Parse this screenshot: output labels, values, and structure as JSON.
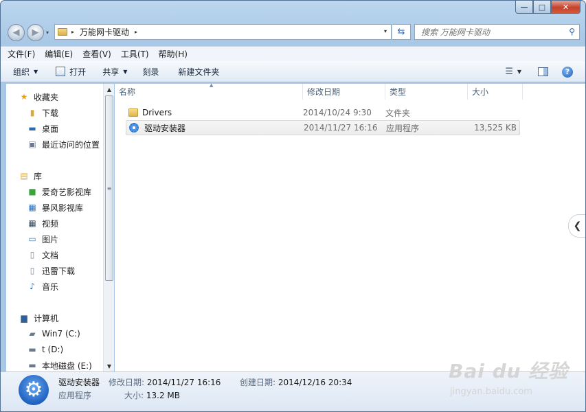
{
  "window": {
    "minimize": "—",
    "maximize": "□",
    "close": "✕"
  },
  "nav": {
    "back": "◀",
    "forward": "▶",
    "dropdown": "▾"
  },
  "address": {
    "crumbs": [
      "万能网卡驱动"
    ],
    "sep": "▸",
    "drop": "▾",
    "refresh": "⇆"
  },
  "search": {
    "placeholder": "搜索 万能网卡驱动",
    "icon": "search-icon"
  },
  "menu": [
    "文件(F)",
    "编辑(E)",
    "查看(V)",
    "工具(T)",
    "帮助(H)"
  ],
  "toolbar": {
    "organize": "组织",
    "open": "打开",
    "share": "共享",
    "burn": "刻录",
    "new_folder": "新建文件夹",
    "help": "?"
  },
  "sidebar": {
    "favorites": {
      "label": "收藏夹",
      "items": [
        "下载",
        "桌面",
        "最近访问的位置"
      ]
    },
    "libraries": {
      "label": "库",
      "items": [
        "爱奇艺影视库",
        "暴风影视库",
        "视频",
        "图片",
        "文档",
        "迅雷下载",
        "音乐"
      ]
    },
    "computer": {
      "label": "计算机",
      "items": [
        "Win7 (C:)",
        "t (D:)",
        "本地磁盘 (E:)"
      ]
    }
  },
  "columns": {
    "name": "名称",
    "modified": "修改日期",
    "type": "类型",
    "size": "大小"
  },
  "files": [
    {
      "name": "Drivers",
      "modified": "2014/10/24 9:30",
      "type": "文件夹",
      "size": ""
    },
    {
      "name": "驱动安装器",
      "modified": "2014/11/27 16:16",
      "type": "应用程序",
      "size": "13,525 KB"
    }
  ],
  "details": {
    "name": "驱动安装器",
    "type": "应用程序",
    "modified_label": "修改日期:",
    "modified": "2014/11/27 16:16",
    "created_label": "创建日期:",
    "created": "2014/12/16 20:34",
    "size_label": "大小:",
    "size": "13.2 MB"
  },
  "watermark": {
    "logo": "Bai du 经验",
    "url": "jingyan.baidu.com"
  }
}
